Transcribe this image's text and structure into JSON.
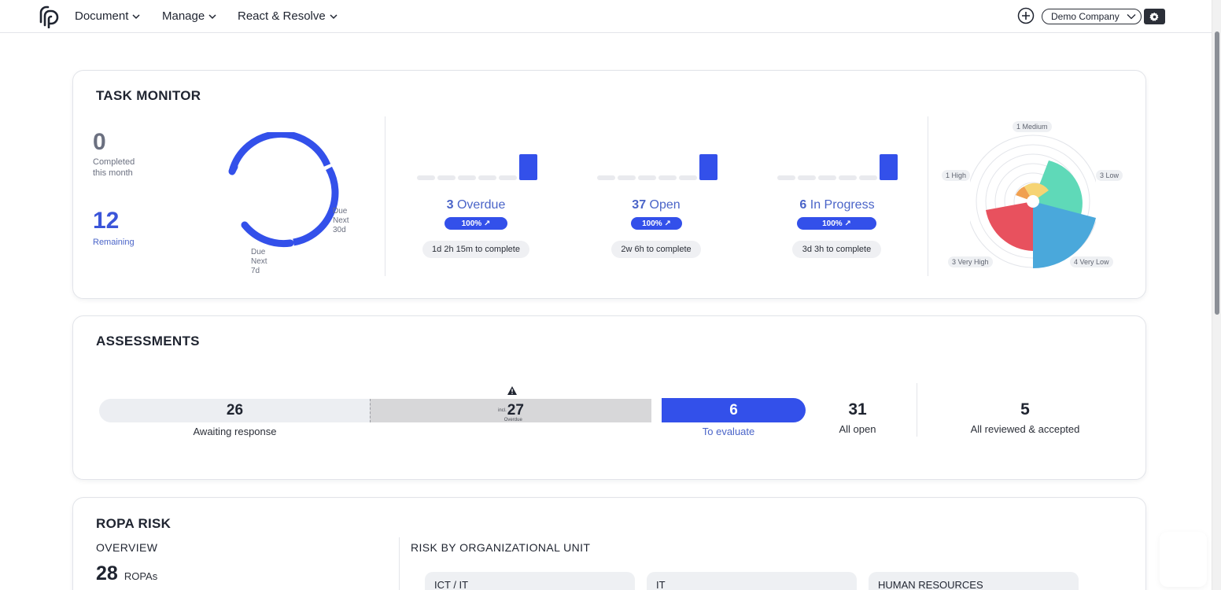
{
  "nav": {
    "items": [
      "Document",
      "Manage",
      "React & Resolve"
    ],
    "company": "Demo Company"
  },
  "task_monitor": {
    "title": "TASK MONITOR",
    "completed_value": "0",
    "completed_label_1": "Completed",
    "completed_label_2": "this month",
    "remaining_value": "12",
    "remaining_label": "Remaining",
    "ring": {
      "label_30d": [
        "Due",
        "Next",
        "30d"
      ],
      "label_7d": [
        "Due",
        "Next",
        "7d"
      ]
    },
    "metrics": [
      {
        "count": "3",
        "label": "Overdue",
        "pct": "100% ↗",
        "time": "1d 2h 15m to complete"
      },
      {
        "count": "37",
        "label": "Open",
        "pct": "100% ↗",
        "time": "2w 6h to complete"
      },
      {
        "count": "6",
        "label": "In Progress",
        "pct": "100% ↗",
        "time": "3d 3h to complete"
      }
    ],
    "radar": {
      "labels": [
        "1 Medium",
        "3 Low",
        "4 Very Low",
        "3 Very High",
        "1 High"
      ]
    }
  },
  "assessments": {
    "title": "ASSESSMENTS",
    "awaiting_value": "26",
    "awaiting_label": "Awaiting response",
    "overdue_value": "27",
    "overdue_prefix": "incl.",
    "overdue_suffix": "Overdue",
    "evaluate_value": "6",
    "evaluate_label": "To evaluate",
    "all_open_value": "31",
    "all_open_label": "All open",
    "reviewed_value": "5",
    "reviewed_label": "All reviewed & accepted"
  },
  "ropa": {
    "title": "ROPA RISK",
    "overview": "OVERVIEW",
    "ropas_value": "28",
    "ropas_label": "ROPAs",
    "by_unit": "RISK BY ORGANIZATIONAL UNIT",
    "units": [
      "ICT / IT",
      "IT",
      "HUMAN RESOURCES"
    ]
  },
  "colors": {
    "accent": "#3350ea",
    "radar_green": "#5fd9b8",
    "radar_blue": "#4aa8db",
    "radar_red": "#e8515e",
    "radar_orange": "#f0a050",
    "radar_yellow": "#f6d474"
  }
}
